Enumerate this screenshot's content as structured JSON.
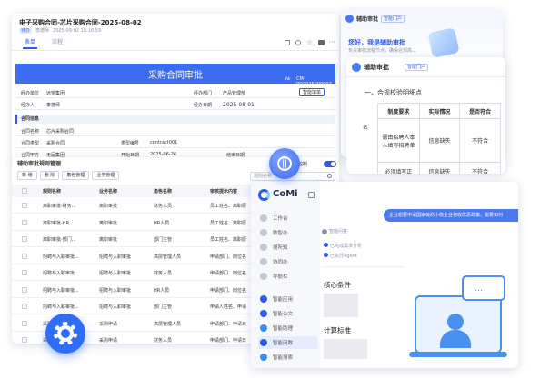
{
  "contract": {
    "title": "电子采购合同-芯片采购合同-2025-08-02",
    "meta_tag": "待办",
    "meta_user": "李德师",
    "meta_date": "2025-09-02 15:16:59",
    "tabs": [
      "表单",
      "流程"
    ],
    "banner": "采购合同审批",
    "banner_no_label": "№",
    "banner_no": "CM-PO2025000002",
    "fields": {
      "dept_label": "经办单位",
      "dept_value": "远望集团",
      "dept2_label": "经办部门",
      "dept2_value": "产品管理部",
      "person_label": "经办人",
      "person_value": "李德师",
      "date_label": "经办日期",
      "date_value": "2025-08-01",
      "smart_fill": "智能填单"
    },
    "section": "合同信息",
    "info": {
      "name_label": "合同名称",
      "name_value": "芯片采购合同",
      "type_label": "合同类型",
      "type_value": "采购合同",
      "cat_label": "类型编号",
      "cat_value": "contract001",
      "party_label": "合同甲方",
      "party_value": "无届集团",
      "start_label": "开始日期",
      "start_value": "2025-06-26",
      "end_label": "结束日期"
    }
  },
  "assistant_back": {
    "title": "辅助审批",
    "badge": "智能门户",
    "greeting": "您好，我是辅助审批",
    "sub": "负责审核流程节点，确保合规高..."
  },
  "assistant_front": {
    "title": "辅助审批",
    "badge": "智能门户",
    "section": "一、合规校验明细点",
    "cut_left": "名",
    "headers": [
      "制度要求",
      "实际情况",
      "是否符合"
    ],
    "rows": [
      [
        "需由招聘人本人填写招聘单",
        "信息缺失",
        "不符合"
      ],
      [
        "必须填写正",
        "信息缺失",
        "不符合"
      ]
    ]
  },
  "list": {
    "title": "辅助审批规则管理",
    "buttons": [
      "新 增",
      "删 除",
      "角色管理",
      "业务管理"
    ],
    "toggle_label": "辅助审批全局控制",
    "search_placeholder": "规则名称",
    "headers": [
      "规则名称",
      "业务名称",
      "角色名称",
      "审核提示内容"
    ],
    "rows": [
      [
        "离职审批-财务...",
        "离职审批",
        "财务人员",
        "员工姓名、离职原"
      ],
      [
        "离职审批-HR...",
        "离职审批",
        "HR人员",
        "员工姓名、离职原"
      ],
      [
        "离职审批-部门...",
        "离职审批",
        "部门主管",
        "员工姓名、离职原"
      ],
      [
        "招聘与入职审批...",
        "招聘与入职审批",
        "高层管理人员",
        "申请部门、岗位名"
      ],
      [
        "招聘与入职审批...",
        "招聘与入职审批",
        "财务人员",
        "申请部门、岗位名"
      ],
      [
        "招聘与入职审批...",
        "招聘与入职审批",
        "HR人员",
        "申请部门、岗位名"
      ],
      [
        "招聘与入职审批...",
        "招聘与入职审批",
        "部门主管",
        "申请人姓名、申请"
      ],
      [
        "采购申请",
        "采购申请",
        "高层管理人员",
        "申请部门、申请日"
      ],
      [
        "采购申请",
        "采购申请",
        "财务人员",
        "申请部门、申请日"
      ]
    ]
  },
  "comi": {
    "brand": "CoMi",
    "nav": [
      "工作台",
      "数智办",
      "搜所知",
      "协同办",
      "导航栏",
      "智能应用",
      "智能公文",
      "智能助理",
      "智能问数",
      "智能搜索"
    ],
    "prompt": "企业想要申请国家级的小微企业税收优惠政策，需要如何",
    "agent_label": "智能问答",
    "steps": [
      "已完成需求分析",
      "已执行Agent"
    ],
    "h1": "核心条件",
    "h2": "计算标准"
  },
  "colors": {
    "brand_blue": "#2f5bea",
    "banner": "#3c6df0",
    "accent_light": "#eaf0ff",
    "chat_bubble": "#4a77f2"
  },
  "icons": [
    "gear-icon",
    "globe-icon",
    "chat-support-illustration",
    "comi-logo"
  ]
}
